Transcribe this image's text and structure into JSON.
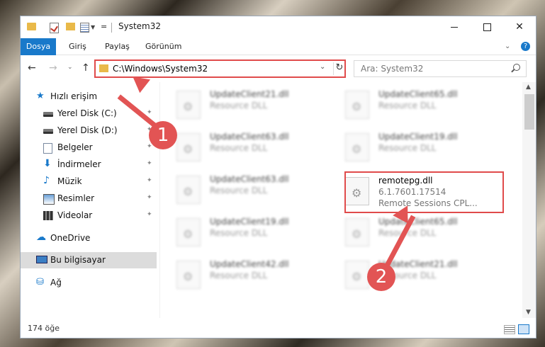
{
  "window": {
    "title": "System32"
  },
  "ribbon": {
    "tabs": [
      "Dosya",
      "Giriş",
      "Paylaş",
      "Görünüm"
    ]
  },
  "address": {
    "path": "C:\\Windows\\System32"
  },
  "search": {
    "placeholder": "Ara: System32"
  },
  "sidebar": {
    "items": [
      {
        "label": "Hızlı erişim",
        "icon": "star-icon"
      },
      {
        "label": "Yerel Disk (C:)",
        "icon": "drive-icon"
      },
      {
        "label": "Yerel Disk (D:)",
        "icon": "drive-icon"
      },
      {
        "label": "Belgeler",
        "icon": "documents-icon"
      },
      {
        "label": "İndirmeler",
        "icon": "download-icon"
      },
      {
        "label": "Müzik",
        "icon": "music-icon"
      },
      {
        "label": "Resimler",
        "icon": "pictures-icon"
      },
      {
        "label": "Videolar",
        "icon": "videos-icon"
      },
      {
        "label": "OneDrive",
        "icon": "cloud-icon"
      },
      {
        "label": "Bu bilgisayar",
        "icon": "computer-icon"
      },
      {
        "label": "Ağ",
        "icon": "network-icon"
      }
    ]
  },
  "files": [
    {
      "name": "UpdateClient21.dll",
      "desc": "Resource DLL"
    },
    {
      "name": "UpdateClient65.dll",
      "desc": "Resource DLL"
    },
    {
      "name": "UpdateClient63.dll",
      "desc": "Resource DLL"
    },
    {
      "name": "UpdateClient19.dll",
      "desc": "Resource DLL"
    },
    {
      "name": "UpdateClient63.dll",
      "desc": "Resource DLL"
    },
    {
      "name": "remotepg.dll",
      "version": "6.1.7601.17514",
      "desc": "Remote Sessions CPL..."
    },
    {
      "name": "UpdateClient19.dll",
      "desc": "Resource DLL"
    },
    {
      "name": "UpdateClient65.dll",
      "desc": "Resource DLL"
    },
    {
      "name": "UpdateClient42.dll",
      "desc": "Resource DLL"
    },
    {
      "name": "UpdateClient21.dll",
      "desc": "Resource DLL"
    }
  ],
  "status": {
    "count": "174 öğe"
  },
  "annotations": {
    "step1": "1",
    "step2": "2",
    "color": "#e04b4b"
  }
}
